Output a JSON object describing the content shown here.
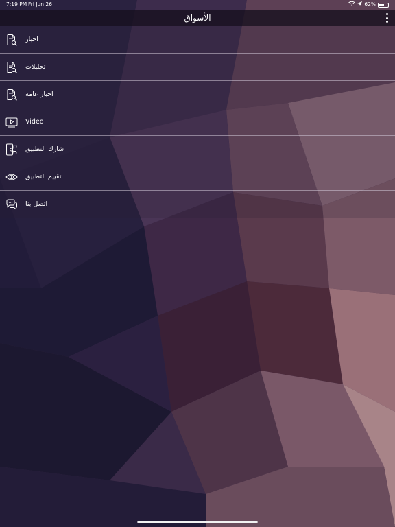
{
  "status_bar": {
    "time": "7:19 PM",
    "date": "Fri Jun 26",
    "battery_text": "62%",
    "battery_level": 0.62
  },
  "header": {
    "title": "الأسواق"
  },
  "menu": {
    "items": [
      {
        "label": "اخبار",
        "icon": "news-search-icon"
      },
      {
        "label": "تحليلات",
        "icon": "analysis-search-icon"
      },
      {
        "label": "اخبار عامة",
        "icon": "general-news-icon"
      },
      {
        "label": "Video",
        "icon": "video-icon"
      },
      {
        "label": "شارك التطبيق",
        "icon": "share-icon"
      },
      {
        "label": "تقييم التطبيق",
        "icon": "eye-icon"
      },
      {
        "label": "اتصل بنا",
        "icon": "chat-icon"
      }
    ]
  },
  "colors": {
    "background_dark": "#1a1530",
    "background_mid": "#4a3050",
    "background_warm": "#8a6070",
    "divider": "#d2c8d7"
  }
}
